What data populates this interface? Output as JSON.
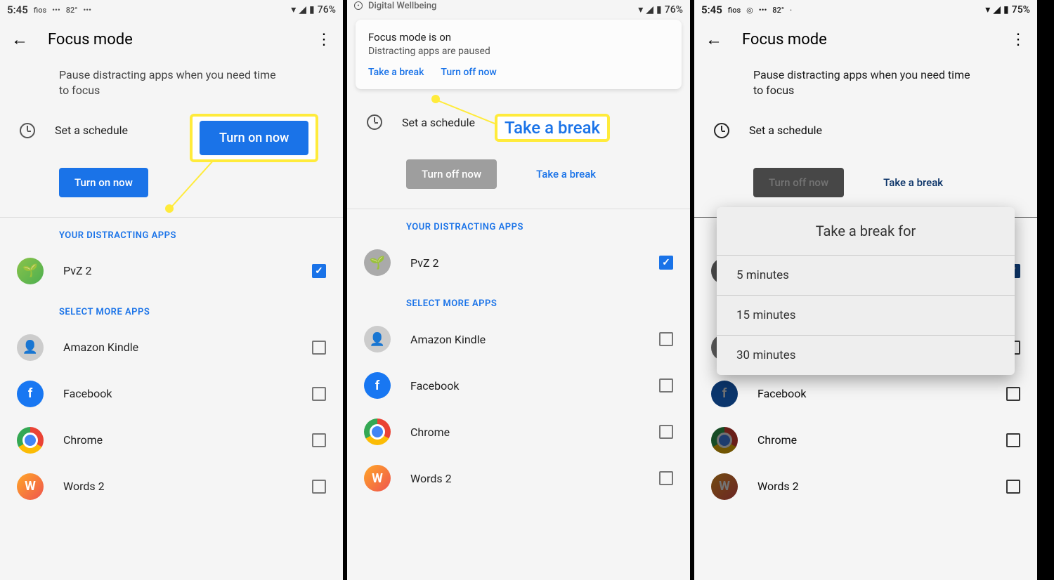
{
  "status": {
    "time": "5:45",
    "carrier": "fios",
    "temp": "82°",
    "battery1": "76%",
    "battery3": "75%"
  },
  "header": {
    "title": "Focus mode"
  },
  "subtitle": "Pause distracting apps when you need time to focus",
  "schedule": "Set a schedule",
  "buttons": {
    "turn_on": "Turn on now",
    "turn_off": "Turn off now",
    "take_break": "Take a break"
  },
  "sections": {
    "distracting": "YOUR DISTRACTING APPS",
    "select_more": "SELECT MORE APPS"
  },
  "apps": {
    "pvz": "PvZ 2",
    "kindle": "Amazon Kindle",
    "fb": "Facebook",
    "chrome": "Chrome",
    "words": "Words 2"
  },
  "callouts": {
    "turn_on": "Turn on now",
    "take_break": "Take a break"
  },
  "notif": {
    "app": "Digital Wellbeing",
    "title": "Focus mode is on",
    "body": "Distracting apps are paused",
    "action1": "Take a break",
    "action2": "Turn off now"
  },
  "dialog": {
    "title": "Take a break for",
    "opt1": "5 minutes",
    "opt2": "15 minutes",
    "opt3": "30 minutes"
  }
}
